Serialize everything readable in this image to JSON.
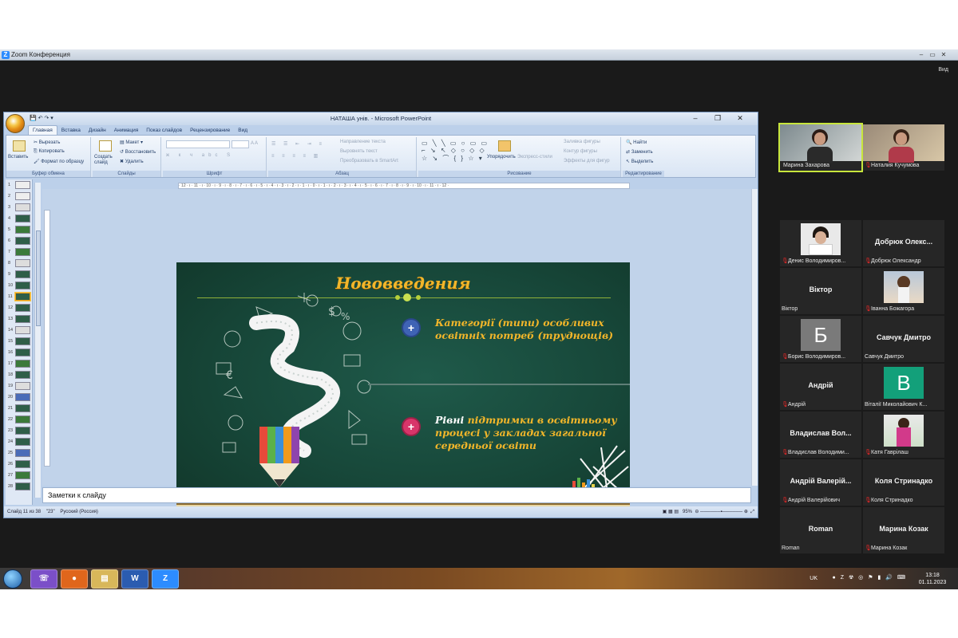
{
  "zoom": {
    "title": "Zoom Конференция",
    "view_label": "Вид"
  },
  "ppt": {
    "caption": "НАТАША унів. - Microsoft PowerPoint",
    "tabs": [
      "Главная",
      "Вставка",
      "Дизайн",
      "Анимация",
      "Показ слайдов",
      "Рецензирование",
      "Вид"
    ],
    "ribbon": {
      "clipboard": {
        "label": "Буфер обмена",
        "paste": "Вставить",
        "cut": "Вырезать",
        "copy": "Копировать",
        "format": "Формат по образцу"
      },
      "slides": {
        "label": "Слайды",
        "new": "Создать слайд",
        "layout": "Макет",
        "reset": "Восстановить",
        "delete": "Удалить"
      },
      "font": {
        "label": "Шрифт"
      },
      "paragraph": {
        "label": "Абзац",
        "direction": "Направление текста",
        "align": "Выровнять текст",
        "smartart": "Преобразовать в SmartArt"
      },
      "drawing": {
        "label": "Рисование",
        "arrange": "Упорядочить",
        "styles": "Экспресс-стили",
        "fill": "Заливка фигуры",
        "outline": "Контур фигуры",
        "effects": "Эффекты для фигур"
      },
      "editing": {
        "label": "Редактирование",
        "find": "Найти",
        "replace": "Заменить",
        "select": "Выделить"
      }
    },
    "slide_numbers": [
      "1",
      "2",
      "3",
      "4",
      "5",
      "6",
      "7",
      "8",
      "9",
      "10",
      "11",
      "12",
      "13",
      "14",
      "15",
      "16",
      "17",
      "18",
      "19",
      "20",
      "21",
      "22",
      "23",
      "24",
      "25",
      "26",
      "27",
      "28"
    ],
    "notes_placeholder": "Заметки к слайду",
    "status": {
      "slide": "Слайд 11 из 38",
      "theme": "\"23\"",
      "lang": "Русский (Россия)",
      "zoom": "95%"
    },
    "ruler_h": "· 12 · ı · 11 · ı · 10 · ı · 9 · ı · 8 · ı · 7 · ı · 6 · ı · 5 · ı · 4 · ı · 3 · ı · 2 · ı · 1 · ı · 0 · ı · 1 · ı · 2 · ı · 3 · ı · 4 · ı · 5 · ı · 6 · ı · 7 · ı · 8 · ı · 9 · ı · 10 · ı · 11 · ı · 12 ·"
  },
  "slide": {
    "title": "Нововведения",
    "bullet1": "Категорії (типи) особливих освітніх потреб (труднощів)",
    "bullet2_lead": "Рівні",
    "bullet2_rest": " підтримки в освітньому процесі у закладах загальної середньої освіти"
  },
  "participants": [
    {
      "name": "Марина Захарова",
      "type": "video"
    },
    {
      "name": "Наталия Кучумова",
      "type": "video"
    },
    {
      "name": "Денис Володимиров...",
      "type": "photo"
    },
    {
      "name": "Добрюк Олександр",
      "type": "text",
      "big": "Добрюк Олекс..."
    },
    {
      "name": "Віктор",
      "type": "text",
      "big": "Віктор"
    },
    {
      "name": "Іванна Божагора",
      "type": "photo"
    },
    {
      "name": "Борис Володимиров...",
      "type": "letter",
      "letter": "Б"
    },
    {
      "name": "Савчук Дмитро",
      "type": "text",
      "big": "Савчук Дмитро"
    },
    {
      "name": "Андрій",
      "type": "text",
      "big": "Андрій"
    },
    {
      "name": "Віталії Миколайович К...",
      "type": "letter",
      "letter": "В"
    },
    {
      "name": "Владислав Володими...",
      "type": "text",
      "big": "Владислав Вол..."
    },
    {
      "name": "Катя Гаврілаш",
      "type": "photo"
    },
    {
      "name": "Андрій Валерійович",
      "type": "text",
      "big": "Андрій Валерій..."
    },
    {
      "name": "Коля Стринадко",
      "type": "text",
      "big": "Коля Стринадко"
    },
    {
      "name": "Roman",
      "type": "text",
      "big": "Roman"
    },
    {
      "name": "Марина Козак",
      "type": "text",
      "big": "Марина Козак"
    }
  ],
  "taskbar": {
    "lang": "UK",
    "time": "13:18",
    "date": "01.11.2023"
  },
  "colors": {
    "slide_bg": "#174739",
    "slide_gold": "#f2b62a",
    "accent_blue": "#3f63b5",
    "accent_pink": "#d8356a",
    "speaker_highlight": "#c8e63c"
  }
}
